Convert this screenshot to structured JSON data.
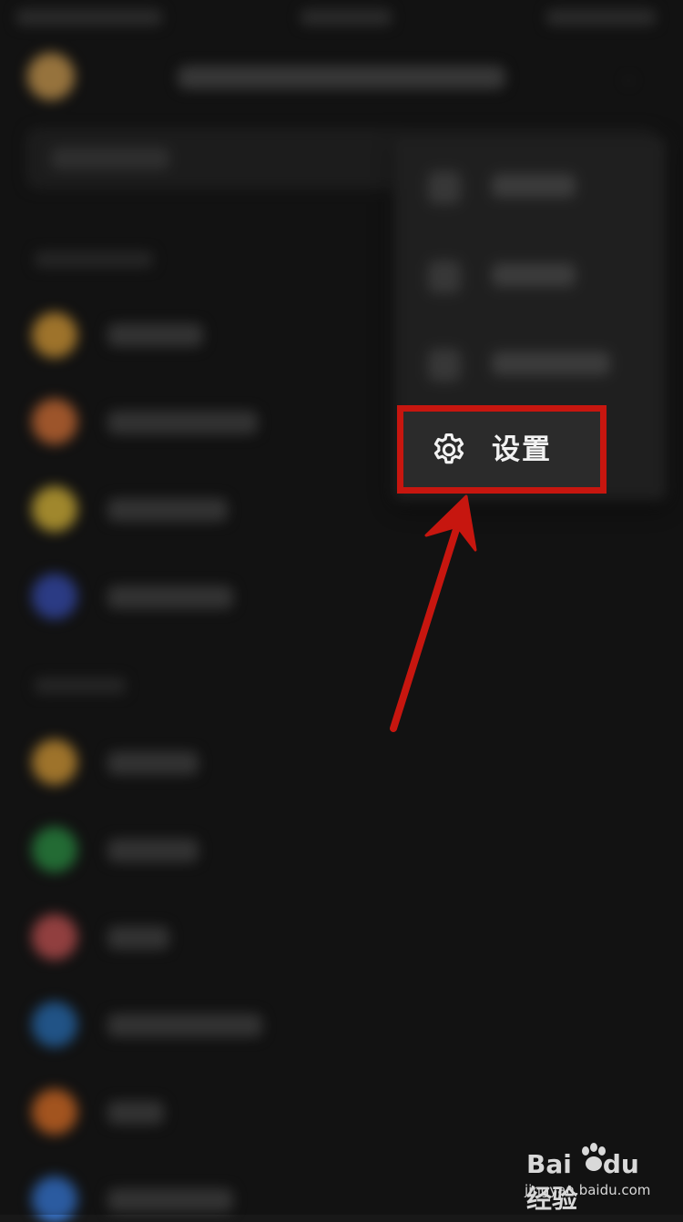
{
  "settings_menu_item": {
    "label": "设置",
    "icon": "gear-icon"
  },
  "watermark": {
    "brand_letters": "Bai",
    "brand_suffix": "du",
    "product": "经验",
    "url": "jingyan.baidu.com"
  },
  "colors": {
    "highlight": "#c7160f",
    "background": "#181818",
    "menu_background": "#2a2a2a",
    "list_icon_colors": [
      "#d39a3a",
      "#d2723a",
      "#d6b53c",
      "#3a4fb0",
      "#d39a3a",
      "#2f8f46",
      "#c25555",
      "#2c6fb3",
      "#d9702a",
      "#3a7ad6"
    ]
  }
}
